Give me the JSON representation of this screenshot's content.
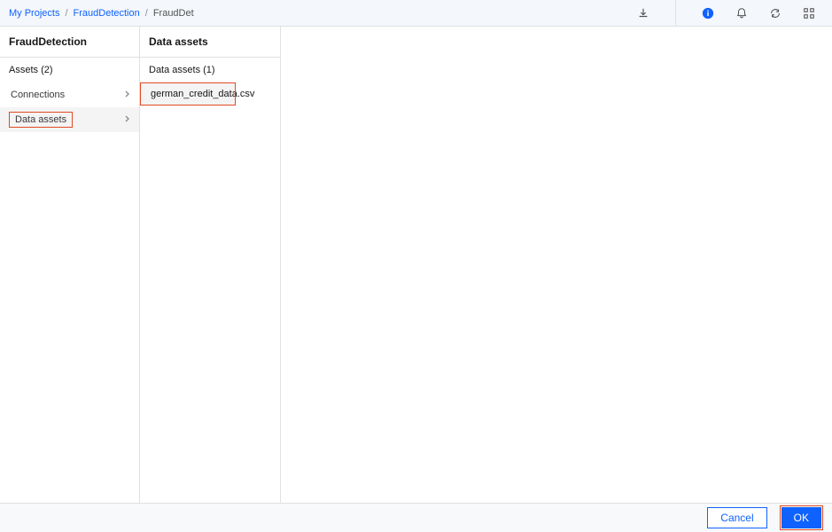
{
  "breadcrumb": {
    "item1": "My Projects",
    "item2": "FraudDetection",
    "current": "FraudDet"
  },
  "col1": {
    "title": "FraudDetection",
    "subtitle": "Assets (2)",
    "items": [
      {
        "label": "Connections"
      },
      {
        "label": "Data assets"
      }
    ]
  },
  "col2": {
    "title": "Data assets",
    "subtitle": "Data assets (1)",
    "items": [
      {
        "label": "german_credit_data.csv"
      }
    ]
  },
  "footer": {
    "cancel": "Cancel",
    "ok": "OK"
  }
}
